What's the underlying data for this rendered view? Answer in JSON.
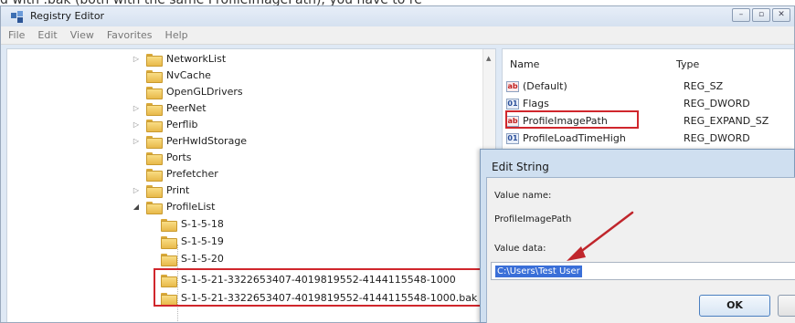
{
  "caption": {
    "text": "d with .bak (both with the same ProfileImagePath), you have to re"
  },
  "window": {
    "title": "Registry Editor",
    "controls": [
      "–",
      "▫",
      "✕"
    ]
  },
  "menu": [
    "File",
    "Edit",
    "View",
    "Favorites",
    "Help"
  ],
  "tree": {
    "items": [
      {
        "label": "NetworkList",
        "expandable": true
      },
      {
        "label": "NvCache",
        "expandable": false
      },
      {
        "label": "OpenGLDrivers",
        "expandable": false
      },
      {
        "label": "PeerNet",
        "expandable": true
      },
      {
        "label": "Perflib",
        "expandable": true
      },
      {
        "label": "PerHwIdStorage",
        "expandable": true
      },
      {
        "label": "Ports",
        "expandable": false
      },
      {
        "label": "Prefetcher",
        "expandable": false
      },
      {
        "label": "Print",
        "expandable": true
      },
      {
        "label": "ProfileList",
        "expandable": true,
        "expanded": true
      },
      {
        "label": "S-1-5-18",
        "expandable": false
      },
      {
        "label": "S-1-5-19",
        "expandable": false
      },
      {
        "label": "S-1-5-20",
        "expandable": false
      },
      {
        "label": "S-1-5-21-3322653407-4019819552-4144115548-1000",
        "expandable": false
      },
      {
        "label": "S-1-5-21-3322653407-4019819552-4144115548-1000.bak",
        "expandable": false
      }
    ]
  },
  "values": {
    "columns": {
      "name": "Name",
      "type": "Type"
    },
    "rows": [
      {
        "icon": "string-value-icon",
        "name": "(Default)",
        "type": "REG_SZ"
      },
      {
        "icon": "binary-value-icon",
        "name": "Flags",
        "type": "REG_DWORD"
      },
      {
        "icon": "string-value-icon",
        "name": "ProfileImagePath",
        "type": "REG_EXPAND_SZ"
      },
      {
        "icon": "binary-value-icon",
        "name": "ProfileLoadTimeHigh",
        "type": "REG_DWORD"
      }
    ]
  },
  "dialog": {
    "title": "Edit String",
    "value_name_label": "Value name:",
    "value_name": "ProfileImagePath",
    "value_data_label": "Value data:",
    "value_data": "C:\\Users\\Test User",
    "ok_label": "OK"
  },
  "colors": {
    "highlight": "#d0262c",
    "selection": "#3a6fd8"
  }
}
